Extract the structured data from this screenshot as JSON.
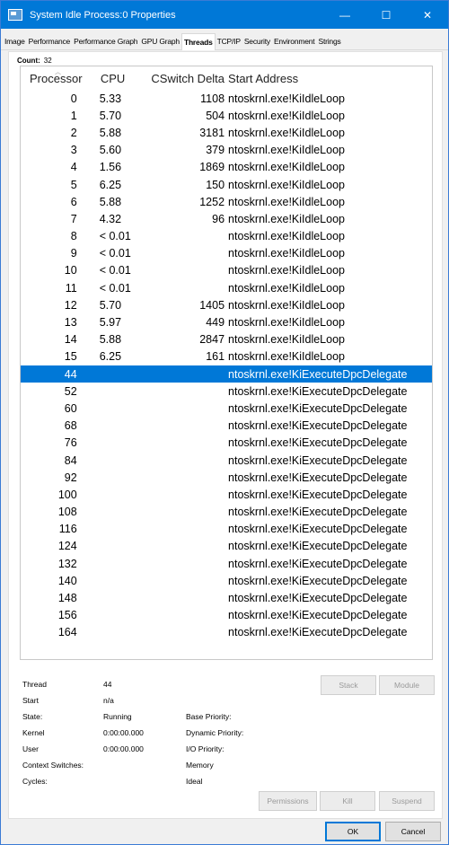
{
  "window": {
    "title": "System Idle Process:0 Properties",
    "minimize": "—",
    "maximize": "☐",
    "close": "✕"
  },
  "tabs": [
    "Image",
    "Performance",
    "Performance Graph",
    "GPU Graph",
    "Threads",
    "TCP/IP",
    "Security",
    "Environment",
    "Strings"
  ],
  "active_tab": "Threads",
  "count": {
    "label": "Count:",
    "value": "32"
  },
  "columns": {
    "processor": "Processor",
    "cpu": "CPU",
    "cswitch": "CSwitch Delta",
    "address": "Start Address"
  },
  "threads": [
    {
      "proc": "0",
      "cpu": "5.33",
      "cs": "1108",
      "addr": "ntoskrnl.exe!KiIdleLoop"
    },
    {
      "proc": "1",
      "cpu": "5.70",
      "cs": "504",
      "addr": "ntoskrnl.exe!KiIdleLoop"
    },
    {
      "proc": "2",
      "cpu": "5.88",
      "cs": "3181",
      "addr": "ntoskrnl.exe!KiIdleLoop"
    },
    {
      "proc": "3",
      "cpu": "5.60",
      "cs": "379",
      "addr": "ntoskrnl.exe!KiIdleLoop"
    },
    {
      "proc": "4",
      "cpu": "1.56",
      "cs": "1869",
      "addr": "ntoskrnl.exe!KiIdleLoop"
    },
    {
      "proc": "5",
      "cpu": "6.25",
      "cs": "150",
      "addr": "ntoskrnl.exe!KiIdleLoop"
    },
    {
      "proc": "6",
      "cpu": "5.88",
      "cs": "1252",
      "addr": "ntoskrnl.exe!KiIdleLoop"
    },
    {
      "proc": "7",
      "cpu": "4.32",
      "cs": "96",
      "addr": "ntoskrnl.exe!KiIdleLoop"
    },
    {
      "proc": "8",
      "cpu": "< 0.01",
      "cs": "",
      "addr": "ntoskrnl.exe!KiIdleLoop"
    },
    {
      "proc": "9",
      "cpu": "< 0.01",
      "cs": "",
      "addr": "ntoskrnl.exe!KiIdleLoop"
    },
    {
      "proc": "10",
      "cpu": "< 0.01",
      "cs": "",
      "addr": "ntoskrnl.exe!KiIdleLoop"
    },
    {
      "proc": "11",
      "cpu": "< 0.01",
      "cs": "",
      "addr": "ntoskrnl.exe!KiIdleLoop"
    },
    {
      "proc": "12",
      "cpu": "5.70",
      "cs": "1405",
      "addr": "ntoskrnl.exe!KiIdleLoop"
    },
    {
      "proc": "13",
      "cpu": "5.97",
      "cs": "449",
      "addr": "ntoskrnl.exe!KiIdleLoop"
    },
    {
      "proc": "14",
      "cpu": "5.88",
      "cs": "2847",
      "addr": "ntoskrnl.exe!KiIdleLoop"
    },
    {
      "proc": "15",
      "cpu": "6.25",
      "cs": "161",
      "addr": "ntoskrnl.exe!KiIdleLoop"
    },
    {
      "proc": "44",
      "cpu": "",
      "cs": "",
      "addr": "ntoskrnl.exe!KiExecuteDpcDelegate",
      "selected": true
    },
    {
      "proc": "52",
      "cpu": "",
      "cs": "",
      "addr": "ntoskrnl.exe!KiExecuteDpcDelegate"
    },
    {
      "proc": "60",
      "cpu": "",
      "cs": "",
      "addr": "ntoskrnl.exe!KiExecuteDpcDelegate"
    },
    {
      "proc": "68",
      "cpu": "",
      "cs": "",
      "addr": "ntoskrnl.exe!KiExecuteDpcDelegate"
    },
    {
      "proc": "76",
      "cpu": "",
      "cs": "",
      "addr": "ntoskrnl.exe!KiExecuteDpcDelegate"
    },
    {
      "proc": "84",
      "cpu": "",
      "cs": "",
      "addr": "ntoskrnl.exe!KiExecuteDpcDelegate"
    },
    {
      "proc": "92",
      "cpu": "",
      "cs": "",
      "addr": "ntoskrnl.exe!KiExecuteDpcDelegate"
    },
    {
      "proc": "100",
      "cpu": "",
      "cs": "",
      "addr": "ntoskrnl.exe!KiExecuteDpcDelegate"
    },
    {
      "proc": "108",
      "cpu": "",
      "cs": "",
      "addr": "ntoskrnl.exe!KiExecuteDpcDelegate"
    },
    {
      "proc": "116",
      "cpu": "",
      "cs": "",
      "addr": "ntoskrnl.exe!KiExecuteDpcDelegate"
    },
    {
      "proc": "124",
      "cpu": "",
      "cs": "",
      "addr": "ntoskrnl.exe!KiExecuteDpcDelegate"
    },
    {
      "proc": "132",
      "cpu": "",
      "cs": "",
      "addr": "ntoskrnl.exe!KiExecuteDpcDelegate"
    },
    {
      "proc": "140",
      "cpu": "",
      "cs": "",
      "addr": "ntoskrnl.exe!KiExecuteDpcDelegate"
    },
    {
      "proc": "148",
      "cpu": "",
      "cs": "",
      "addr": "ntoskrnl.exe!KiExecuteDpcDelegate"
    },
    {
      "proc": "156",
      "cpu": "",
      "cs": "",
      "addr": "ntoskrnl.exe!KiExecuteDpcDelegate"
    },
    {
      "proc": "164",
      "cpu": "",
      "cs": "",
      "addr": "ntoskrnl.exe!KiExecuteDpcDelegate"
    }
  ],
  "details": {
    "thread_label": "Thread",
    "thread_value": "44",
    "start_label": "Start",
    "start_value": "n/a",
    "state_label": "State:",
    "state_value": "Running",
    "kernel_label": "Kernel",
    "kernel_value": "0:00:00.000",
    "user_label": "User",
    "user_value": "0:00:00.000",
    "cs_label": "Context Switches:",
    "cycles_label": "Cycles:",
    "base_priority_label": "Base Priority:",
    "dynamic_priority_label": "Dynamic Priority:",
    "io_priority_label": "I/O Priority:",
    "memory_label": "Memory",
    "ideal_label": "Ideal"
  },
  "buttons": {
    "stack": "Stack",
    "module": "Module",
    "permissions": "Permissions",
    "kill": "Kill",
    "suspend": "Suspend",
    "ok": "OK",
    "cancel": "Cancel"
  },
  "colors": {
    "accent": "#0078d7"
  }
}
